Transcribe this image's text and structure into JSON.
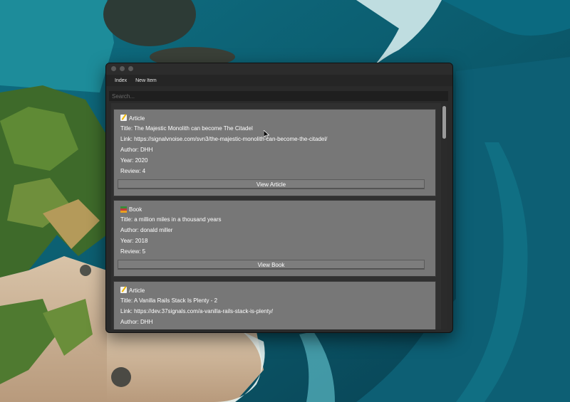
{
  "colors": {
    "window_bg": "#2a2a2a",
    "card_bg": "#777777",
    "text": "#ffffff"
  },
  "menu": {
    "items": [
      "Index",
      "New Item"
    ]
  },
  "search": {
    "placeholder": "Search..."
  },
  "cards": [
    {
      "type_icon": "pencil-memo-icon",
      "type": "Article",
      "title": "Title: The Majestic Monolith can become The Citadel",
      "link": "Link: https://signalvnoise.com/svn3/the-majestic-monolith-can-become-the-citadel/",
      "author": "Author: DHH",
      "year": "Year: 2020",
      "review": "Review: 4",
      "button": "View Article"
    },
    {
      "type_icon": "books-icon",
      "type": "Book",
      "title": "Title: a million miles in a thousand years",
      "author": "Author: donald miller",
      "year": "Year: 2018",
      "review": "Review: 5",
      "button": "View Book"
    },
    {
      "type_icon": "pencil-memo-icon",
      "type": "Article",
      "title": "Title: A Vanilla Rails Stack Is Plenty - 2",
      "link": "Link: https://dev.37signals.com/a-vanilla-rails-stack-is-plenty/",
      "author": "Author: DHH"
    }
  ]
}
